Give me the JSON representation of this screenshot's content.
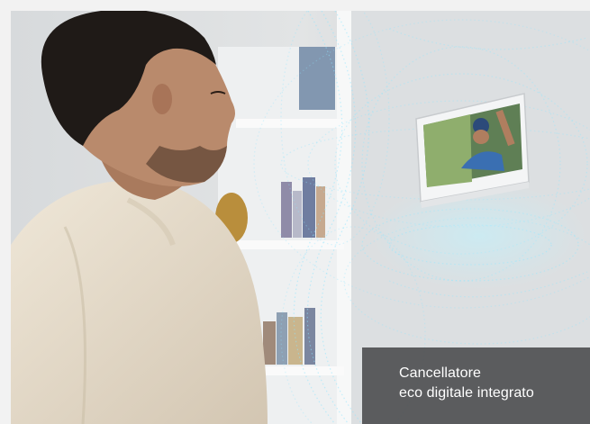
{
  "caption": {
    "line1": "Cancellatore",
    "line2": "eco digitale integrato"
  },
  "colors": {
    "page_background": "#f2f2f2",
    "wall": "#d9dcdf",
    "shelf": "#eef0f1",
    "sweater": "#e6dccb",
    "skin": "#b98a6c",
    "hair": "#1f1a17",
    "wave_glow": "#7fe4ff",
    "caption_background": "#464648",
    "caption_text": "#ffffff"
  },
  "icons": [
    "person-photo",
    "video-intercom-monitor",
    "sound-wave-pattern"
  ]
}
